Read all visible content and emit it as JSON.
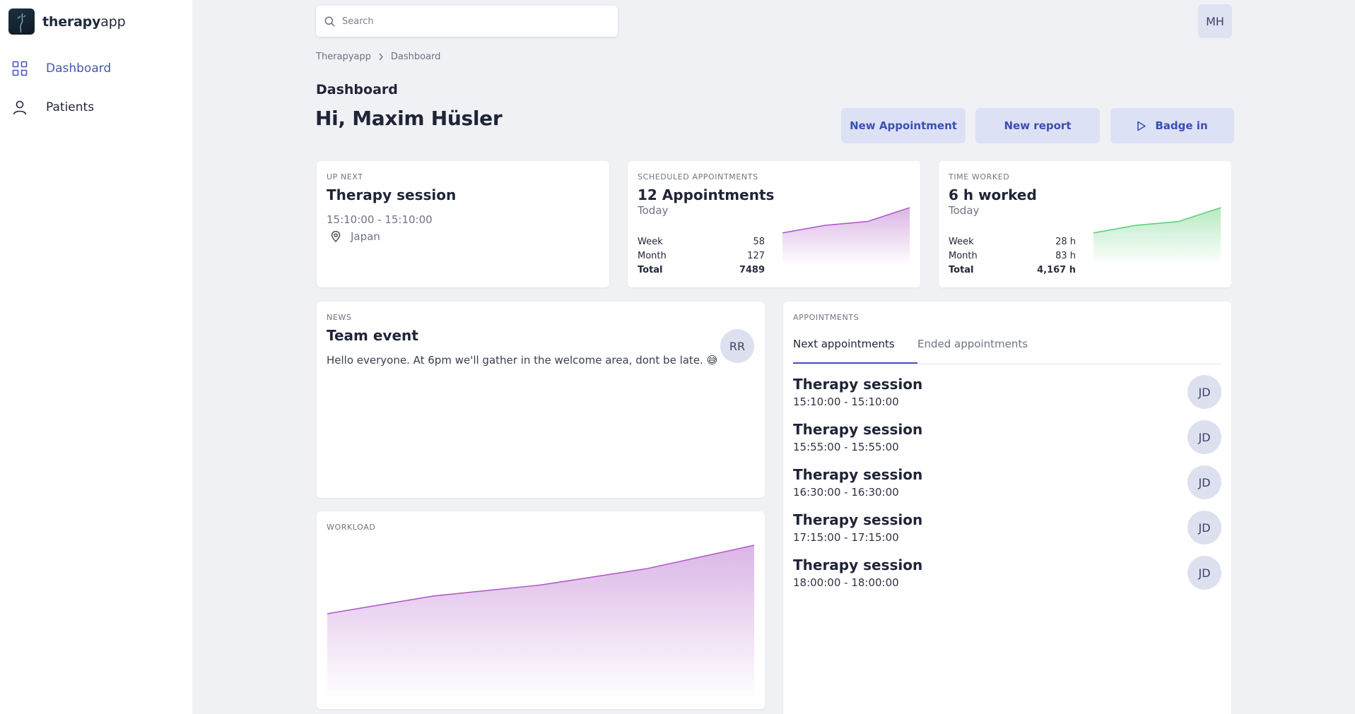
{
  "brand": {
    "name_bold": "therapy",
    "name_light": "app"
  },
  "sidebar": {
    "items": [
      {
        "label": "Dashboard",
        "icon": "grid-icon",
        "active": true
      },
      {
        "label": "Patients",
        "icon": "user-icon",
        "active": false
      }
    ]
  },
  "search": {
    "placeholder": "Search"
  },
  "user": {
    "initials": "MH"
  },
  "breadcrumb": [
    "Therapyapp",
    "Dashboard"
  ],
  "page": {
    "section_title": "Dashboard",
    "greeting": "Hi, Maxim Hüsler"
  },
  "actions": {
    "new_appointment": "New Appointment",
    "new_report": "New report",
    "badge_in": "Badge in"
  },
  "up_next": {
    "eyebrow": "UP NEXT",
    "title": "Therapy session",
    "time": "15:10:00 - 15:10:00",
    "location": "Japan"
  },
  "scheduled": {
    "eyebrow": "SCHEDULED APPOINTMENTS",
    "title": "12 Appointments",
    "subtitle": "Today",
    "rows": [
      {
        "label": "Week",
        "value": "58"
      },
      {
        "label": "Month",
        "value": "127"
      },
      {
        "label": "Total",
        "value": "7489"
      }
    ],
    "color": "#b05cc8",
    "trend": [
      0,
      0.3,
      0.45,
      1
    ]
  },
  "time_worked": {
    "eyebrow": "TIME WORKED",
    "title": "6 h worked",
    "subtitle": "Today",
    "rows": [
      {
        "label": "Week",
        "value": "28 h"
      },
      {
        "label": "Month",
        "value": "83 h"
      },
      {
        "label": "Total",
        "value": "4,167 h"
      }
    ],
    "color": "#5fd07a",
    "trend": [
      0,
      0.3,
      0.45,
      1
    ]
  },
  "news": {
    "eyebrow": "NEWS",
    "title": "Team event",
    "body": "Hello everyone. At 6pm we'll gather in the welcome area, dont be late. 😅",
    "author_initials": "RR"
  },
  "workload": {
    "eyebrow": "WORKLOAD",
    "color": "#b05cc8",
    "trend": [
      0,
      0.26,
      0.42,
      0.66,
      1
    ]
  },
  "appointments": {
    "eyebrow": "APPOINTMENTS",
    "tabs": [
      "Next appointments",
      "Ended appointments"
    ],
    "items": [
      {
        "title": "Therapy session",
        "time": "15:10:00 - 15:10:00",
        "initials": "JD"
      },
      {
        "title": "Therapy session",
        "time": "15:55:00 - 15:55:00",
        "initials": "JD"
      },
      {
        "title": "Therapy session",
        "time": "16:30:00 - 16:30:00",
        "initials": "JD"
      },
      {
        "title": "Therapy session",
        "time": "17:15:00 - 17:15:00",
        "initials": "JD"
      },
      {
        "title": "Therapy session",
        "time": "18:00:00 - 18:00:00",
        "initials": "JD"
      }
    ]
  }
}
